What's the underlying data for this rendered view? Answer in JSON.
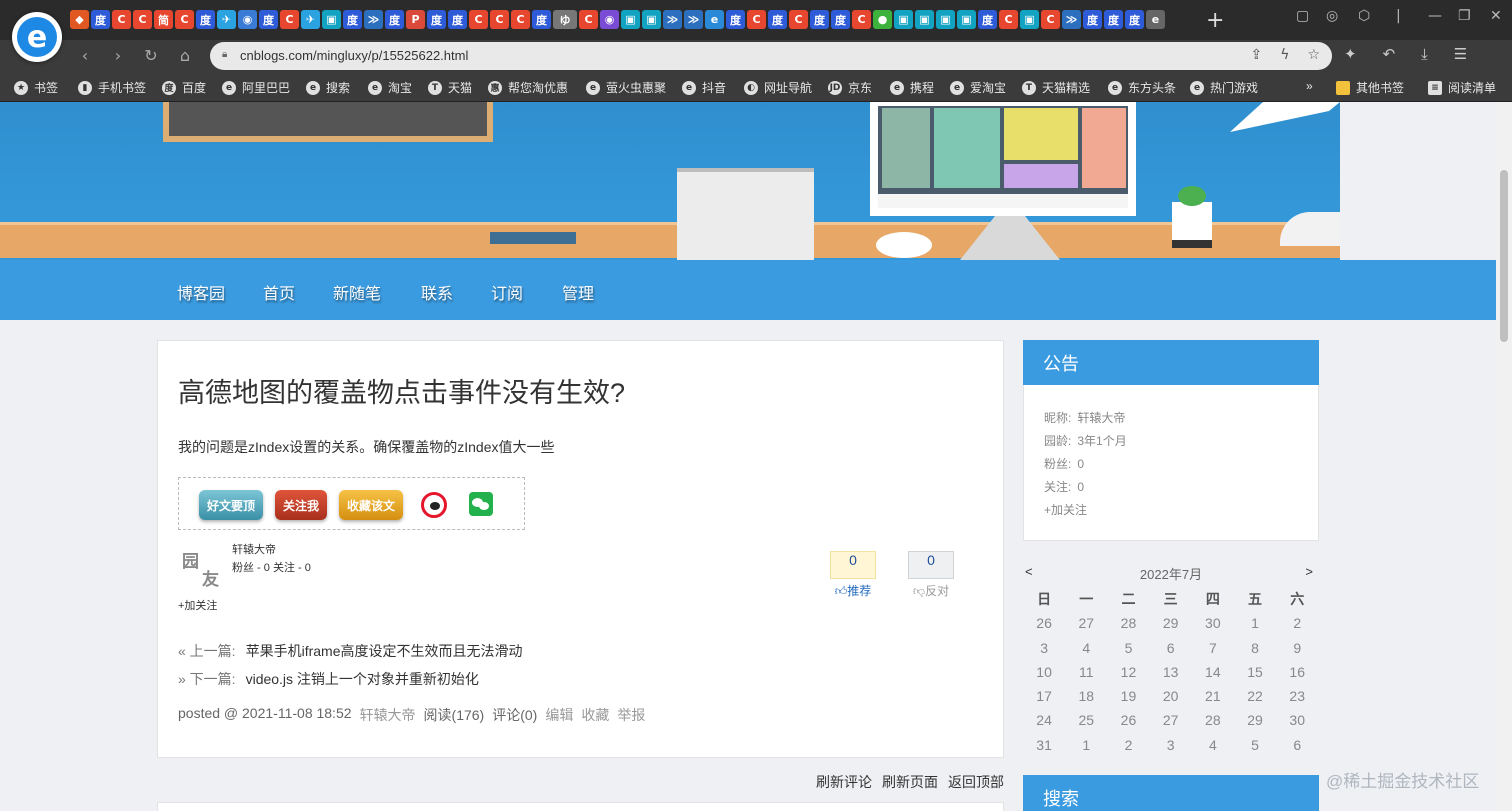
{
  "browser": {
    "logo_letter": "e",
    "url": "cnblogs.com/mingluxy/p/15525622.html",
    "new_tab": "+",
    "bookmarks": [
      {
        "label": "书签",
        "icon": "★"
      },
      {
        "label": "手机书签",
        "icon": "▮"
      },
      {
        "label": "百度",
        "icon": "度"
      },
      {
        "label": "阿里巴巴",
        "icon": "e"
      },
      {
        "label": "搜索",
        "icon": "e"
      },
      {
        "label": "淘宝",
        "icon": "e"
      },
      {
        "label": "天猫",
        "icon": "T"
      },
      {
        "label": "帮您淘优惠",
        "icon": "惠"
      },
      {
        "label": "萤火虫惠聚",
        "icon": "e"
      },
      {
        "label": "抖音",
        "icon": "e"
      },
      {
        "label": "网址导航",
        "icon": "◐"
      },
      {
        "label": "京东",
        "icon": "JD"
      },
      {
        "label": "携程",
        "icon": "e"
      },
      {
        "label": "爱淘宝",
        "icon": "e"
      },
      {
        "label": "天猫精选",
        "icon": "T"
      },
      {
        "label": "东方头条",
        "icon": "e"
      },
      {
        "label": "热门游戏",
        "icon": "e"
      }
    ],
    "more_bookmarks": "»",
    "other_bookmarks": "其他书签",
    "reading_list": "阅读清单",
    "tab_icons": [
      {
        "glyph": "◆",
        "color": "#e25822"
      },
      {
        "glyph": "度",
        "color": "#2e5bd8"
      },
      {
        "glyph": "C",
        "color": "#e8472f"
      },
      {
        "glyph": "C",
        "color": "#e8472f"
      },
      {
        "glyph": "简",
        "color": "#e8472f"
      },
      {
        "glyph": "C",
        "color": "#e8472f"
      },
      {
        "glyph": "度",
        "color": "#2e5bd8"
      },
      {
        "glyph": "✈",
        "color": "#2aa3e0"
      },
      {
        "glyph": "◉",
        "color": "#3a7bd5"
      },
      {
        "glyph": "度",
        "color": "#2e5bd8"
      },
      {
        "glyph": "C",
        "color": "#e8472f"
      },
      {
        "glyph": "✈",
        "color": "#2aa3e0"
      },
      {
        "glyph": "▣",
        "color": "#13a3c2"
      },
      {
        "glyph": "度",
        "color": "#2e5bd8"
      },
      {
        "glyph": "≫",
        "color": "#2d6fbf"
      },
      {
        "glyph": "度",
        "color": "#2e5bd8"
      },
      {
        "glyph": "P",
        "color": "#d94a3a"
      },
      {
        "glyph": "度",
        "color": "#2e5bd8"
      },
      {
        "glyph": "度",
        "color": "#2e5bd8"
      },
      {
        "glyph": "C",
        "color": "#e8472f"
      },
      {
        "glyph": "C",
        "color": "#e8472f"
      },
      {
        "glyph": "C",
        "color": "#e8472f"
      },
      {
        "glyph": "度",
        "color": "#2e5bd8"
      },
      {
        "glyph": "ゆ",
        "color": "#777777"
      },
      {
        "glyph": "C",
        "color": "#e8472f"
      },
      {
        "glyph": "◉",
        "color": "#7a4bd5"
      },
      {
        "glyph": "▣",
        "color": "#13a3c2"
      },
      {
        "glyph": "▣",
        "color": "#13a3c2"
      },
      {
        "glyph": "≫",
        "color": "#2d6fbf"
      },
      {
        "glyph": "≫",
        "color": "#2d6fbf"
      },
      {
        "glyph": "e",
        "color": "#2a8ad8"
      },
      {
        "glyph": "度",
        "color": "#2e5bd8"
      },
      {
        "glyph": "C",
        "color": "#e8472f"
      },
      {
        "glyph": "度",
        "color": "#2e5bd8"
      },
      {
        "glyph": "C",
        "color": "#e8472f"
      },
      {
        "glyph": "度",
        "color": "#2e5bd8"
      },
      {
        "glyph": "度",
        "color": "#2e5bd8"
      },
      {
        "glyph": "C",
        "color": "#e8472f"
      },
      {
        "glyph": "●",
        "color": "#3db33d"
      },
      {
        "glyph": "▣",
        "color": "#13a3c2"
      },
      {
        "glyph": "▣",
        "color": "#13a3c2"
      },
      {
        "glyph": "▣",
        "color": "#13a3c2"
      },
      {
        "glyph": "▣",
        "color": "#13a3c2"
      },
      {
        "glyph": "度",
        "color": "#2e5bd8"
      },
      {
        "glyph": "C",
        "color": "#e8472f"
      },
      {
        "glyph": "▣",
        "color": "#13a3c2"
      },
      {
        "glyph": "C",
        "color": "#e8472f"
      },
      {
        "glyph": "≫",
        "color": "#2d6fbf"
      },
      {
        "glyph": "度",
        "color": "#2e5bd8"
      },
      {
        "glyph": "度",
        "color": "#2e5bd8"
      },
      {
        "glyph": "度",
        "color": "#2e5bd8"
      },
      {
        "glyph": "e",
        "color": "#666666"
      }
    ]
  },
  "blog": {
    "nav": [
      "博客园",
      "首页",
      "新随笔",
      "联系",
      "订阅",
      "管理"
    ],
    "post": {
      "title": "高德地图的覆盖物点击事件没有生效?",
      "body": "我的问题是zIndex设置的关系。确保覆盖物的zIndex值大一些",
      "share_buttons": {
        "top": "好文要顶",
        "follow": "关注我",
        "favorite": "收藏该文"
      },
      "author": {
        "avatar_text": [
          "园",
          "友"
        ],
        "name": "轩辕大帝",
        "stats": "粉丝 - 0 关注 - 0",
        "follow": "+加关注"
      },
      "digg": {
        "count": "0",
        "label": "推荐"
      },
      "bury": {
        "count": "0",
        "label": "反对"
      },
      "prev": {
        "tag": "« 上一篇:",
        "title": "苹果手机iframe高度设定不生效而且无法滑动"
      },
      "next": {
        "tag": "» 下一篇:",
        "title": "video.js 注销上一个对象并重新初始化"
      },
      "footer": {
        "posted": "posted @ 2021-11-08 18:52",
        "author": "轩辕大帝",
        "reads": "阅读(176)",
        "comments": "评论(0)",
        "edit": "编辑",
        "collect": "收藏",
        "report": "举报"
      }
    },
    "bottom_links": [
      "刷新评论",
      "刷新页面",
      "返回顶部"
    ],
    "notice": {
      "title": "公告",
      "rows": [
        {
          "label": "昵称:",
          "value": "轩辕大帝"
        },
        {
          "label": "园龄:",
          "value": "3年1个月"
        },
        {
          "label": "粉丝:",
          "value": "0"
        },
        {
          "label": "关注:",
          "value": "0"
        }
      ],
      "follow": "+加关注"
    },
    "calendar": {
      "prev": "<",
      "next": ">",
      "month": "2022年7月",
      "weekdays": [
        "日",
        "一",
        "二",
        "三",
        "四",
        "五",
        "六"
      ],
      "weeks": [
        [
          "26",
          "27",
          "28",
          "29",
          "30",
          "1",
          "2"
        ],
        [
          "3",
          "4",
          "5",
          "6",
          "7",
          "8",
          "9"
        ],
        [
          "10",
          "11",
          "12",
          "13",
          "14",
          "15",
          "16"
        ],
        [
          "17",
          "18",
          "19",
          "20",
          "21",
          "22",
          "23"
        ],
        [
          "24",
          "25",
          "26",
          "27",
          "28",
          "29",
          "30"
        ],
        [
          "31",
          "1",
          "2",
          "3",
          "4",
          "5",
          "6"
        ]
      ]
    },
    "search_title": "搜索",
    "watermark": "@稀土掘金技术社区"
  }
}
